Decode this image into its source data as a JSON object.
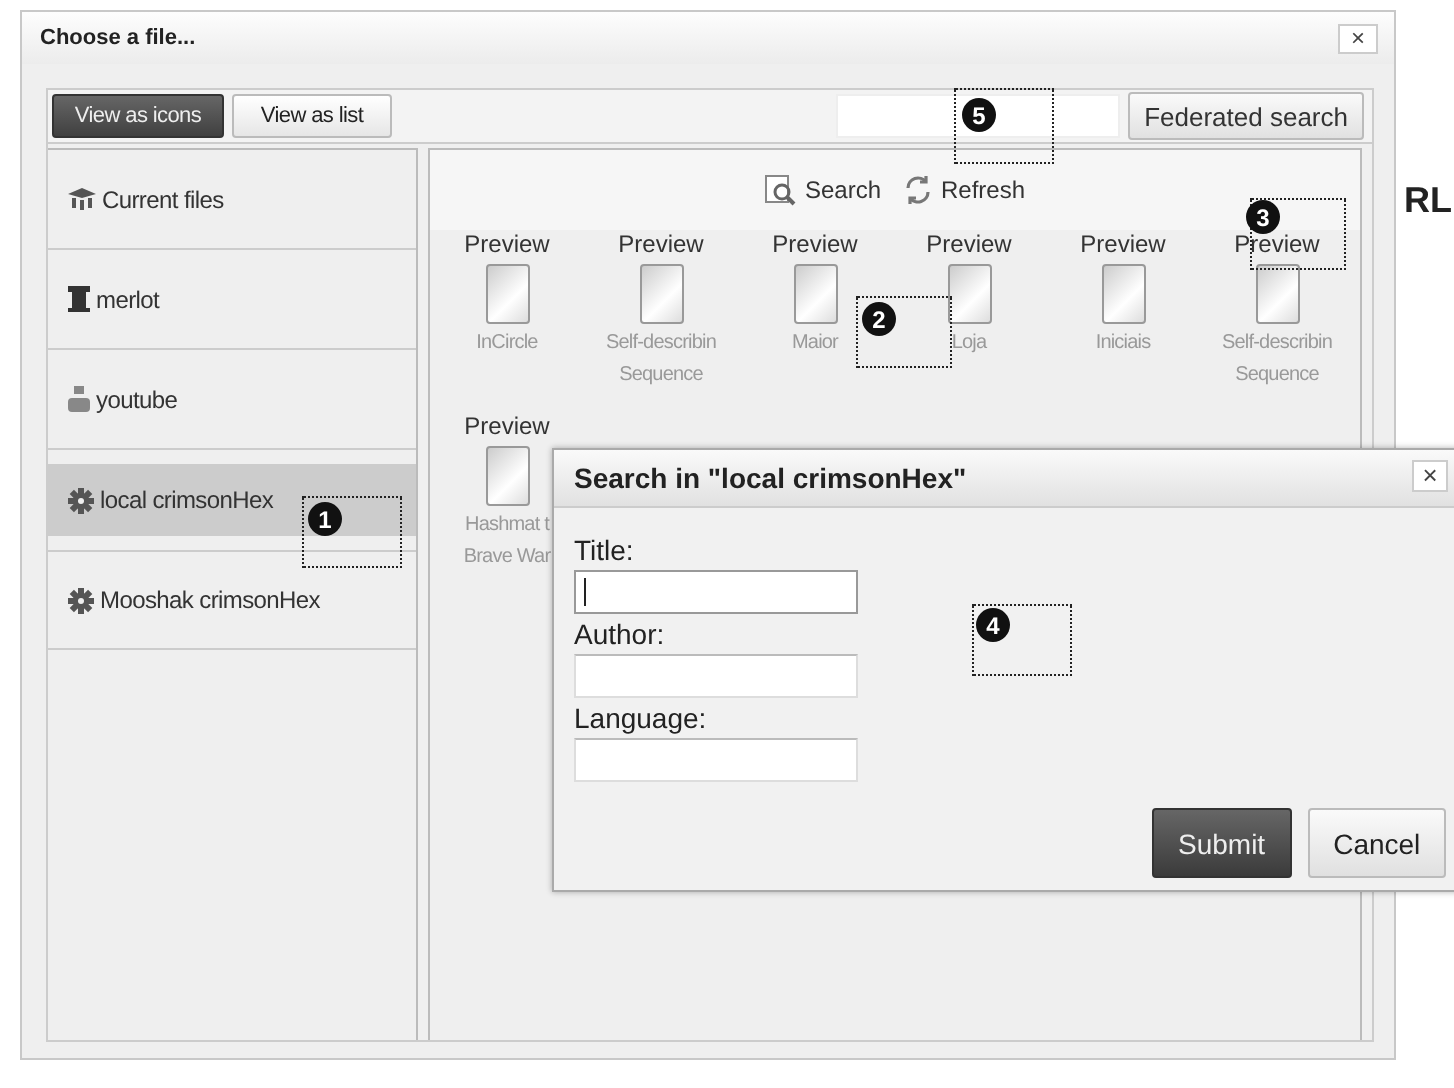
{
  "background": {
    "text": "RL"
  },
  "dialog": {
    "title": "Choose a file...",
    "close": "×"
  },
  "view_buttons": [
    {
      "label": "View as icons",
      "selected": true
    },
    {
      "label": "View as list",
      "selected": false
    }
  ],
  "federated_search_button": "Federated search",
  "sources": [
    {
      "label": "Current files",
      "kind": "moodle",
      "selected": false
    },
    {
      "label": "merlot",
      "kind": "column",
      "selected": false
    },
    {
      "label": "youtube",
      "kind": "tube",
      "selected": false
    },
    {
      "label": "local crimsonHex",
      "kind": "gear",
      "selected": true
    },
    {
      "label": "Mooshak crimsonHex",
      "kind": "gear",
      "selected": false
    }
  ],
  "file_toolbar": [
    {
      "label": "Search",
      "kind": "search"
    },
    {
      "label": "Refresh",
      "kind": "refresh"
    }
  ],
  "files": [
    {
      "preview": "Preview",
      "name": "InCircle"
    },
    {
      "preview": "Preview",
      "name": "Self-describin\nSequence"
    },
    {
      "preview": "Preview",
      "name": "Maior"
    },
    {
      "preview": "Preview",
      "name": "Loja"
    },
    {
      "preview": "Preview",
      "name": "Iniciais"
    },
    {
      "preview": "Preview",
      "name": "Self-describin\nSequence"
    },
    {
      "preview": "Preview",
      "name": "Hashmat t\nBrave War"
    }
  ],
  "search_modal": {
    "title": "Search in \"local crimsonHex\"",
    "close": "×",
    "fields": [
      {
        "label": "Title:",
        "focused": true
      },
      {
        "label": "Author:",
        "focused": false
      },
      {
        "label": "Language:",
        "focused": false
      }
    ],
    "buttons": [
      {
        "label": "Submit",
        "kind": "primary"
      },
      {
        "label": "Cancel",
        "kind": "secondary"
      }
    ]
  },
  "callouts": [
    {
      "label": "1"
    },
    {
      "label": "2"
    },
    {
      "label": "3"
    },
    {
      "label": "4"
    },
    {
      "label": "5"
    }
  ]
}
